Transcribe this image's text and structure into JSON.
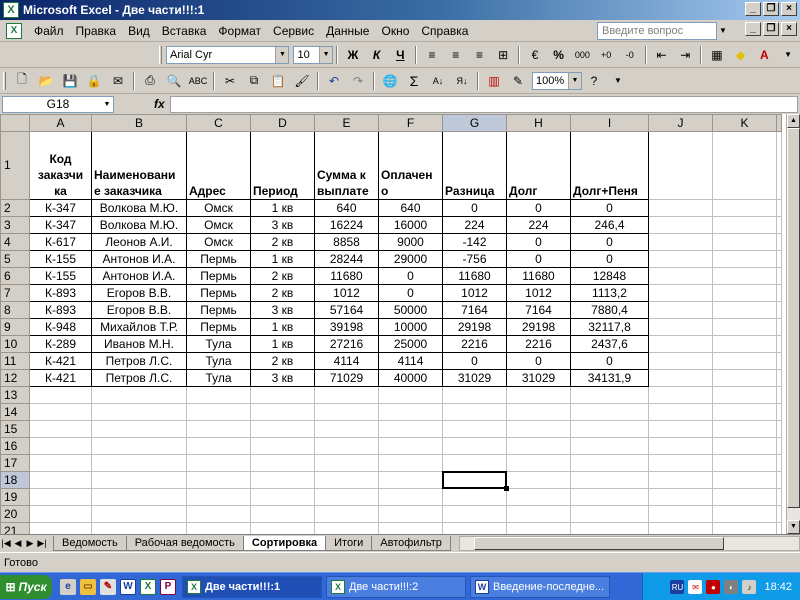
{
  "window": {
    "title": "Microsoft Excel - Две части!!!:1",
    "logo": "X"
  },
  "menu": {
    "items": [
      "Файл",
      "Правка",
      "Вид",
      "Вставка",
      "Формат",
      "Сервис",
      "Данные",
      "Окно",
      "Справка"
    ],
    "help_placeholder": "Введите вопрос"
  },
  "format_toolbar": {
    "font": "Arial Cyr",
    "size": "10",
    "bold": "Ж",
    "italic": "К",
    "underline": "Ч",
    "percent": "%",
    "thousands": "000",
    "zoom": "100%"
  },
  "formula_bar": {
    "name_box": "G18",
    "fx": "fx",
    "content": ""
  },
  "sheet": {
    "columns": [
      "A",
      "B",
      "C",
      "D",
      "E",
      "F",
      "G",
      "H",
      "I",
      "J",
      "K"
    ],
    "row_numbers": [
      "1",
      "2",
      "3",
      "4",
      "5",
      "6",
      "7",
      "8",
      "9",
      "10",
      "11",
      "12",
      "13",
      "14",
      "15",
      "16",
      "17",
      "18",
      "19",
      "20",
      "21",
      "22"
    ],
    "headers": [
      "Код заказчика",
      "Наименование заказчика",
      "Адрес",
      "Период",
      "Сумма к выплате",
      "Оплачено",
      "Разница",
      "Долг",
      "Долг+Пеня"
    ],
    "header_lines": [
      [
        "Код",
        "заказчи",
        "ка"
      ],
      [
        "Наименовани",
        "е заказчика"
      ],
      [
        "Адрес"
      ],
      [
        "Период"
      ],
      [
        "Сумма к",
        "выплате"
      ],
      [
        "Оплачен",
        "о"
      ],
      [
        "Разница"
      ],
      [
        "Долг"
      ],
      [
        "Долг+Пеня"
      ]
    ],
    "rows": [
      [
        "К-347",
        "Волкова М.Ю.",
        "Омск",
        "1 кв",
        "640",
        "640",
        "0",
        "0",
        "0"
      ],
      [
        "К-347",
        "Волкова М.Ю.",
        "Омск",
        "3 кв",
        "16224",
        "16000",
        "224",
        "224",
        "246,4"
      ],
      [
        "К-617",
        "Леонов А.И.",
        "Омск",
        "2 кв",
        "8858",
        "9000",
        "-142",
        "0",
        "0"
      ],
      [
        "К-155",
        "Антонов И.А.",
        "Пермь",
        "1 кв",
        "28244",
        "29000",
        "-756",
        "0",
        "0"
      ],
      [
        "К-155",
        "Антонов И.А.",
        "Пермь",
        "2 кв",
        "11680",
        "0",
        "11680",
        "11680",
        "12848"
      ],
      [
        "К-893",
        "Егоров В.В.",
        "Пермь",
        "2 кв",
        "1012",
        "0",
        "1012",
        "1012",
        "1113,2"
      ],
      [
        "К-893",
        "Егоров В.В.",
        "Пермь",
        "3 кв",
        "57164",
        "50000",
        "7164",
        "7164",
        "7880,4"
      ],
      [
        "К-948",
        "Михайлов Т.Р.",
        "Пермь",
        "1 кв",
        "39198",
        "10000",
        "29198",
        "29198",
        "32117,8"
      ],
      [
        "К-289",
        "Иванов М.Н.",
        "Тула",
        "1 кв",
        "27216",
        "25000",
        "2216",
        "2216",
        "2437,6"
      ],
      [
        "К-421",
        "Петров Л.С.",
        "Тула",
        "2 кв",
        "4114",
        "4114",
        "0",
        "0",
        "0"
      ],
      [
        "К-421",
        "Петров Л.С.",
        "Тула",
        "3 кв",
        "71029",
        "40000",
        "31029",
        "31029",
        "34131,9"
      ]
    ],
    "selected_cell": "G18"
  },
  "tabs": {
    "nav": [
      "|◀",
      "◀",
      "▶",
      "▶|"
    ],
    "items": [
      "Ведомость",
      "Рабочая ведомость",
      "Сортировка",
      "Итоги",
      "Автофильтр"
    ],
    "active": "Сортировка"
  },
  "status": {
    "text": "Готово"
  },
  "taskbar": {
    "start": "Пуск",
    "tasks": [
      "Две части!!!:1",
      "Две части!!!:2",
      "Введение-последне..."
    ],
    "lang": "RU",
    "clock": "18:42"
  }
}
